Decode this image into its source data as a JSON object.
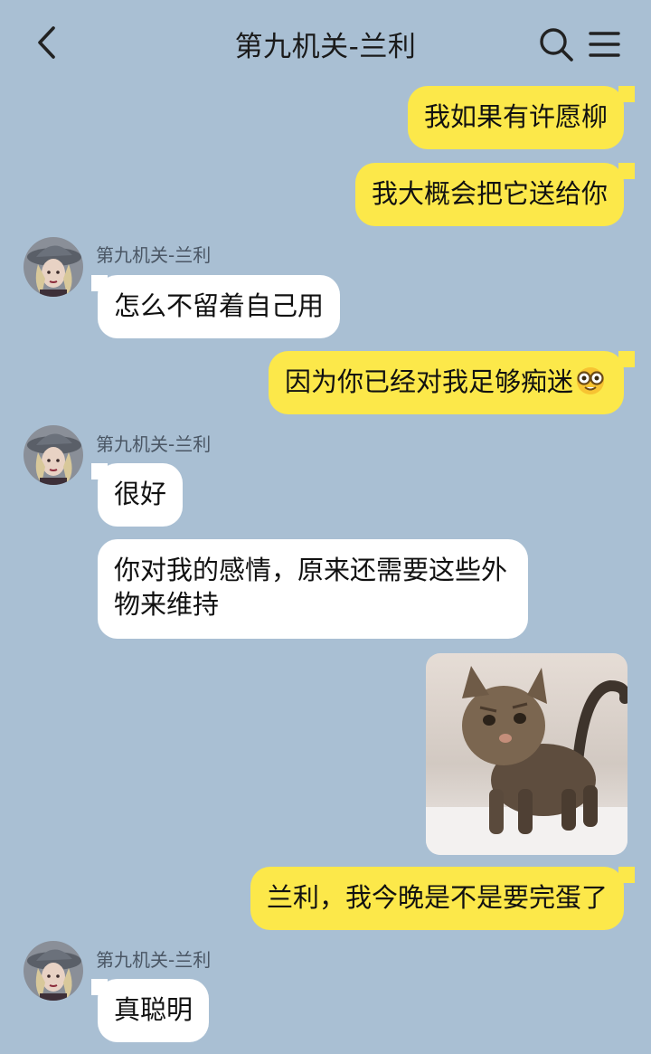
{
  "header": {
    "title": "第九机关-兰利",
    "back_icon": "chevron-left-icon",
    "search_icon": "search-icon",
    "menu_icon": "menu-icon"
  },
  "colors": {
    "background": "#a9bfd3",
    "my_bubble": "#fce84a",
    "their_bubble": "#ffffff"
  },
  "messages": [
    {
      "from": "me",
      "text": "我如果有许愿柳"
    },
    {
      "from": "me",
      "text": "我大概会把它送给你"
    },
    {
      "from": "other",
      "sender": "第九机关-兰利",
      "text": "怎么不留着自己用"
    },
    {
      "from": "me",
      "text": "因为你已经对我足够痴迷",
      "emoji": "nerd-face-emoji"
    },
    {
      "from": "other",
      "sender": "第九机关-兰利",
      "text": "很好"
    },
    {
      "from": "other",
      "text": "你对我的感情，原来还需要这些外物来维持"
    },
    {
      "from": "me",
      "type": "image",
      "image": "cat-photo"
    },
    {
      "from": "me",
      "text": "兰利，我今晚是不是要完蛋了"
    },
    {
      "from": "other",
      "sender": "第九机关-兰利",
      "text": "真聪明"
    }
  ]
}
